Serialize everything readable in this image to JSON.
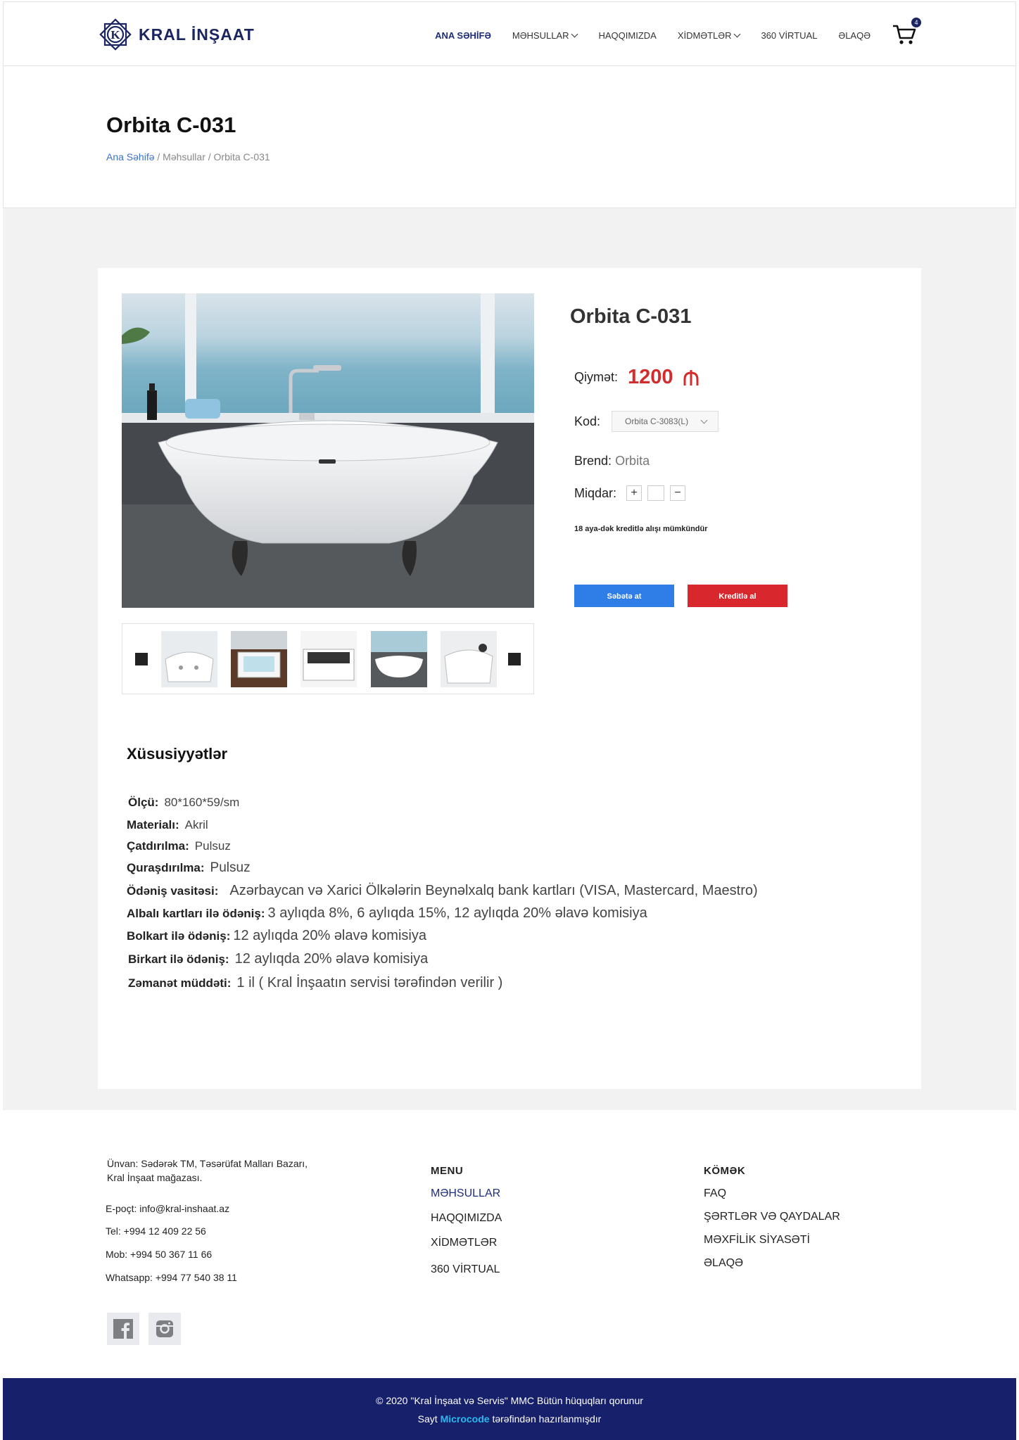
{
  "header": {
    "logo_text": "KRAL İNŞAAT",
    "nav": [
      {
        "label": "ANA SƏHİFƏ"
      },
      {
        "label": "MƏHSULLAR"
      },
      {
        "label": "HAQQIMIZDA"
      },
      {
        "label": "XİDMƏTLƏR"
      },
      {
        "label": "360 VİRTUAL"
      },
      {
        "label": "ƏLAQƏ"
      }
    ],
    "cart_count": "4"
  },
  "titlebar": {
    "title": "Orbita C-031",
    "crumb_home": "Ana Səhifə",
    "crumb_sep1": " / ",
    "crumb_products": "Məhsullar",
    "crumb_sep2": " / ",
    "crumb_current": "Orbita C-031"
  },
  "product": {
    "name": "Orbita C-031",
    "price_label": "Qiymət:",
    "price": "1200",
    "currency_icon": "manat-icon",
    "kod_label": "Kod:",
    "kod_value": "Orbita C-3083(L)",
    "brand_label": "Brend:",
    "brand_value": "Orbita",
    "qty_label": "Miqdar:",
    "qty_plus": "+",
    "qty_minus": "−",
    "credit_note": "18 aya-dək kreditlə alışı mümkündür",
    "add_to_cart": "Səbətə at",
    "buy_credit": "Kreditlə al",
    "thumbnail_count": 5
  },
  "features": {
    "title": "Xüsusiyyətlər",
    "items": [
      {
        "label": "Ölçü:",
        "value": "80*160*59/sm"
      },
      {
        "label": "Materialı:",
        "value": "Akril"
      },
      {
        "label": "Çatdırılma:",
        "value": "Pulsuz"
      },
      {
        "label": "Quraşdırılma:",
        "value": "Pulsuz"
      },
      {
        "label": "Ödəniş vasitəsi:",
        "value": "Azərbaycan və Xarici Ölkələrin Beynəlxalq bank kartları (VISA, Mastercard, Maestro)"
      },
      {
        "label": "Albalı kartları ilə ödəniş:",
        "value": "3 aylıqda 8%, 6 aylıqda 15%, 12 aylıqda 20% əlavə komisiya"
      },
      {
        "label": "Bolkart ilə ödəniş:",
        "value": "12 aylıqda 20% əlavə komisiya"
      },
      {
        "label": "Birkart ilə ödəniş:",
        "value": "12 aylıqda 20% əlavə komisiya"
      },
      {
        "label": "Zəmanət müddəti:",
        "value": "1 il ( Kral İnşaatın servisi tərəfindən verilir )"
      }
    ]
  },
  "footer": {
    "address_label": "Ünvan:",
    "address_line1": "Sədərək TM, Təsərüfat Malları Bazarı,",
    "address_line2": "Kral İnşaat mağazası.",
    "email": "E-poçt: info@kral-inshaat.az",
    "tel": "Tel: +994 12 409 22 56",
    "mob": "Mob: +994 50 367 11 66",
    "whatsapp": "Whatsapp: +994 77 540 38 11",
    "menu_title": "MENU",
    "menu": [
      "MƏHSULLAR",
      "HAQQIMIZDA",
      "XİDMƏTLƏR",
      "360 VİRTUAL"
    ],
    "help_title": "KÖMƏK",
    "help": [
      "FAQ",
      "ŞƏRTLƏR VƏ QAYDALAR",
      "MƏXFİLİK SİYASƏTİ",
      "ƏLAQƏ"
    ],
    "social": [
      "facebook-icon",
      "instagram-icon"
    ],
    "copyright": "© 2020 \"Kral İnşaat və Servis\" MMC Bütün hüquqları qorunur",
    "made_by_prefix": "Sayt",
    "made_by_brand": "Microcode",
    "made_by_suffix": "tərəfindən hazırlanmışdır"
  }
}
